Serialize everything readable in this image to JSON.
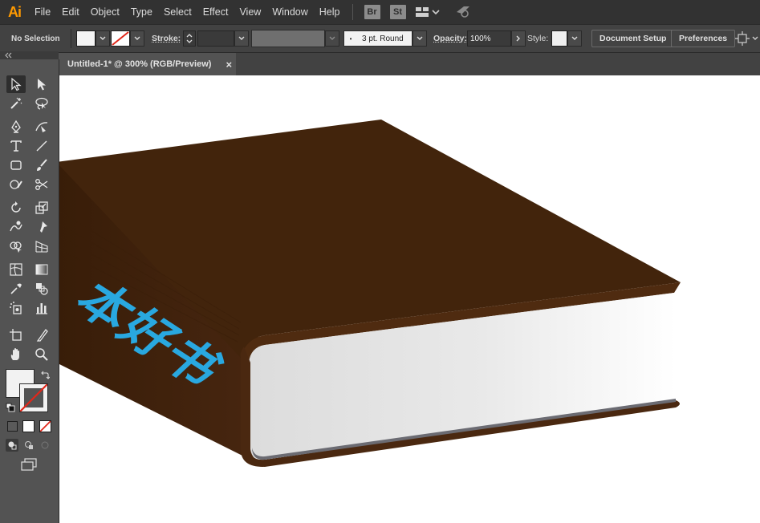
{
  "app": {
    "logo": "Ai"
  },
  "menu": [
    "File",
    "Edit",
    "Object",
    "Type",
    "Select",
    "Effect",
    "View",
    "Window",
    "Help"
  ],
  "bridge_buttons": [
    "Br",
    "St"
  ],
  "control_bar": {
    "selection_status": "No Selection",
    "stroke_label": "Stroke:",
    "brush_value": "3 pt. Round",
    "opacity_label": "Opacity:",
    "opacity_value": "100%",
    "style_label": "Style:",
    "document_setup": "Document Setup",
    "preferences": "Preferences"
  },
  "document_tab": {
    "title": "Untitled-1* @ 300% (RGB/Preview)",
    "close": "×"
  },
  "tools": [
    "selection-tool",
    "direct-selection-tool",
    "magic-wand-tool",
    "lasso-tool",
    "pen-tool",
    "curvature-tool",
    "type-tool",
    "line-segment-tool",
    "rectangle-tool",
    "paintbrush-tool",
    "shaper-tool",
    "scissors-tool",
    "rotate-tool",
    "scale-tool",
    "warp-tool",
    "puppet-warp-tool",
    "shape-builder-tool",
    "perspective-grid-tool",
    "mesh-tool",
    "gradient-tool",
    "eyedropper-tool",
    "blend-tool",
    "symbol-sprayer-tool",
    "column-graph-tool",
    "artboard-tool",
    "slice-tool",
    "hand-tool",
    "zoom-tool"
  ],
  "artwork": {
    "spine_text": "本好书",
    "colors": {
      "cover": "#42240c",
      "cover_shadow": "#2f1807",
      "pages_light": "#ffffff",
      "pages_dark": "#dedede",
      "spine_text": "#29a8e0",
      "accent": "#ff9a00"
    }
  }
}
